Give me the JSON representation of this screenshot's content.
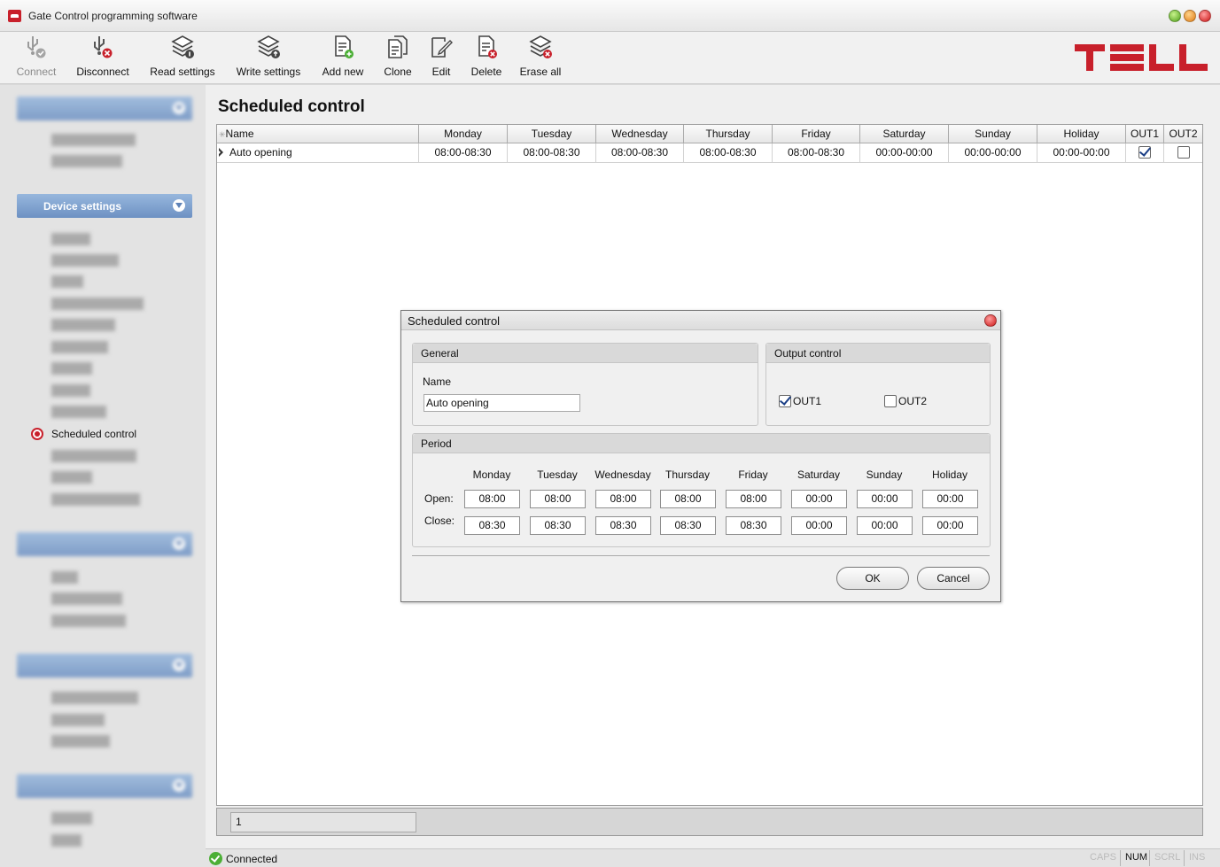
{
  "app": {
    "title": "Gate Control programming software"
  },
  "toolbar": {
    "connect": "Connect",
    "disconnect": "Disconnect",
    "read_settings": "Read settings",
    "write_settings": "Write settings",
    "add_new": "Add new",
    "clone": "Clone",
    "edit": "Edit",
    "delete": "Delete",
    "erase_all": "Erase all"
  },
  "logo": {
    "text": "TELL",
    "color": "#c8202b"
  },
  "sidebar": {
    "device_settings_header": "Device settings",
    "active_item": "Scheduled control"
  },
  "main": {
    "title": "Scheduled control",
    "columns": [
      "Name",
      "Monday",
      "Tuesday",
      "Wednesday",
      "Thursday",
      "Friday",
      "Saturday",
      "Sunday",
      "Holiday",
      "OUT1",
      "OUT2"
    ],
    "rows": [
      {
        "name": "Auto opening",
        "monday": "08:00-08:30",
        "tuesday": "08:00-08:30",
        "wednesday": "08:00-08:30",
        "thursday": "08:00-08:30",
        "friday": "08:00-08:30",
        "saturday": "00:00-00:00",
        "sunday": "00:00-00:00",
        "holiday": "00:00-00:00",
        "out1": true,
        "out2": false
      }
    ],
    "page": "1"
  },
  "status": {
    "text": "Connected",
    "caps": "CAPS",
    "num": "NUM",
    "scrl": "SCRL",
    "ins": "INS"
  },
  "dialog": {
    "title": "Scheduled control",
    "general_header": "General",
    "name_label": "Name",
    "name_value": "Auto opening",
    "output_header": "Output control",
    "out1_label": "OUT1",
    "out1_checked": true,
    "out2_label": "OUT2",
    "out2_checked": false,
    "period_header": "Period",
    "days": [
      "Monday",
      "Tuesday",
      "Wednesday",
      "Thursday",
      "Friday",
      "Saturday",
      "Sunday",
      "Holiday"
    ],
    "open_label": "Open:",
    "close_label": "Close:",
    "open_times": [
      "08:00",
      "08:00",
      "08:00",
      "08:00",
      "08:00",
      "00:00",
      "00:00",
      "00:00"
    ],
    "close_times": [
      "08:30",
      "08:30",
      "08:30",
      "08:30",
      "08:30",
      "00:00",
      "00:00",
      "00:00"
    ],
    "ok_label": "OK",
    "cancel_label": "Cancel"
  }
}
